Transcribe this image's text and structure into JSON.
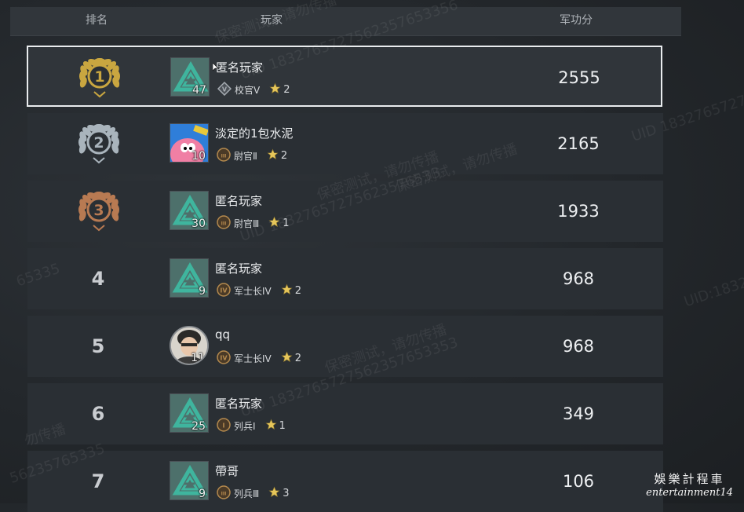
{
  "header": {
    "rank": "排名",
    "player": "玩家",
    "score": "军功分"
  },
  "rows": [
    {
      "rank": "1",
      "name": "匿名玩家",
      "level": "47",
      "rank_title": "校官V",
      "rank_icon": "V",
      "stars": "2",
      "score": "2555"
    },
    {
      "rank": "2",
      "name": "淡定的1包水泥",
      "level": "10",
      "rank_title": "尉官Ⅱ",
      "rank_icon": "III",
      "stars": "2",
      "score": "2165"
    },
    {
      "rank": "3",
      "name": "匿名玩家",
      "level": "30",
      "rank_title": "尉官Ⅲ",
      "rank_icon": "III",
      "stars": "1",
      "score": "1933"
    },
    {
      "rank": "4",
      "name": "匿名玩家",
      "level": "9",
      "rank_title": "军士长IV",
      "rank_icon": "IV",
      "stars": "2",
      "score": "968"
    },
    {
      "rank": "5",
      "name": "qq",
      "level": "11",
      "rank_title": "军士长IV",
      "rank_icon": "IV",
      "stars": "2",
      "score": "968"
    },
    {
      "rank": "6",
      "name": "匿名玩家",
      "level": "25",
      "rank_title": "列兵Ⅰ",
      "rank_icon": "I",
      "stars": "1",
      "score": "349"
    },
    {
      "rank": "7",
      "name": "帶哥",
      "level": "9",
      "rank_title": "列兵Ⅲ",
      "rank_icon": "III",
      "stars": "3",
      "score": "106"
    }
  ],
  "watermarks": [
    "保密测试，请勿传播",
    "UID 1832765727562357653356",
    "保密测试，请勿传播",
    "UID 18327657275623576533",
    "保密测试，请勿传播",
    "UID 1832765727562357653353",
    "UID:18327",
    "UID 1832765727562357",
    "勿传播",
    "56235765335",
    "65335",
    "保密测试，请勿传播"
  ],
  "brand": {
    "title": "娛樂計程車",
    "subtitle": "entertainment14"
  },
  "colors": {
    "gold": "#c9a640",
    "silver": "#a9b4bc",
    "bronze": "#b87a52",
    "teal": "#3fb59e",
    "star": "#e6c65a"
  }
}
